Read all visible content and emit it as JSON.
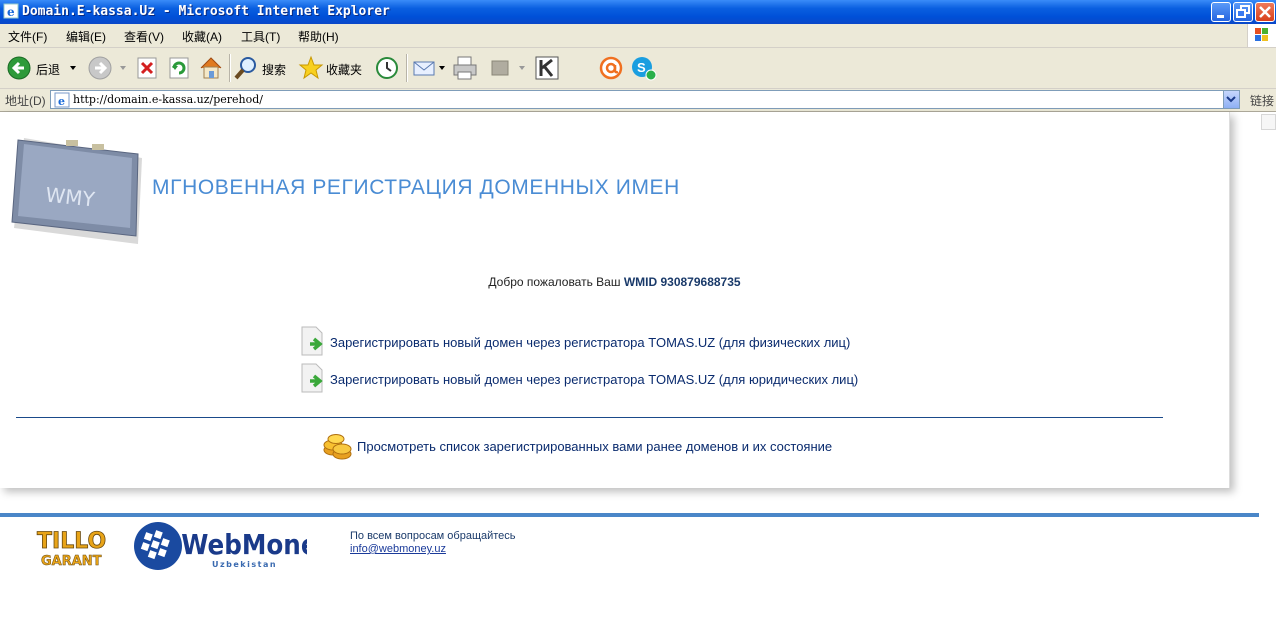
{
  "window": {
    "title": "Domain.E-kassa.Uz - Microsoft Internet Explorer"
  },
  "menu": [
    "文件(F)",
    "编辑(E)",
    "查看(V)",
    "收藏(A)",
    "工具(T)",
    "帮助(H)"
  ],
  "toolbar": {
    "back_label": "后退",
    "search_label": "搜索",
    "favorites_label": "收藏夹"
  },
  "address": {
    "label": "地址(D)",
    "url": "http://domain.e-kassa.uz/perehod/",
    "links_label": "链接"
  },
  "page": {
    "logo_text": "WMY",
    "heading": "МГНОВЕННАЯ РЕГИСТРАЦИЯ ДОМЕННЫХ ИМЕН",
    "welcome_prefix": "Добро пожаловать Ваш ",
    "welcome_wmid": "WMID 930879688735",
    "links": [
      "Зарегистрировать новый домен через регистратора TOMAS.UZ (для физических лиц)",
      "Зарегистрировать новый домен через регистратора TOMAS.UZ (для юридических лиц)"
    ],
    "list_link": "Просмотреть список зарегистрированных вами ранее доменов и их состояние"
  },
  "footer": {
    "tillo_line1": "TILLO",
    "tillo_line2": "GARANT",
    "webmoney": "WebMoney",
    "webmoney_sub": "Uzbekistan",
    "contact_text": "По всем вопросам обращайтесь",
    "email": "info@webmoney.uz"
  },
  "colors": {
    "heading": "#4a8cd4",
    "link": "#0a2b6e",
    "footer_bar": "#4a86c8",
    "titlebar": "#0a5fe0"
  }
}
